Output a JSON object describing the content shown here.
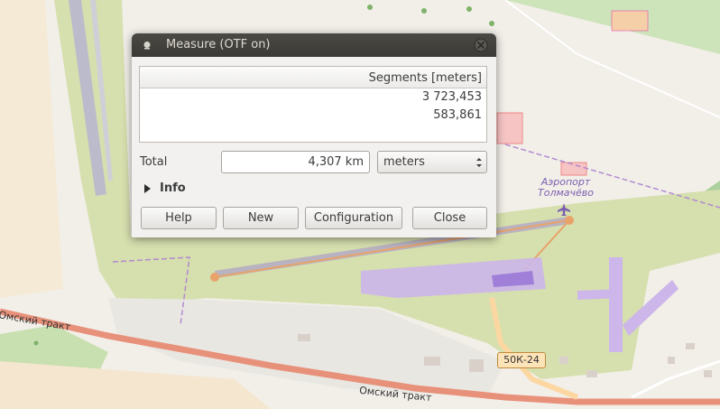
{
  "map": {
    "road_labels": [
      "Омский тракт",
      "Омский тракт"
    ],
    "road_shield": "50К-24",
    "airport_label": "Аэропорт Толмачёво",
    "icons": [
      "airport-icon",
      "tree-icon"
    ],
    "colors": {
      "land": "#f2efe9",
      "airport_grass": "#d6dfae",
      "runway": "#bbbbcc",
      "terminal": "#ccb6ea",
      "main_road": "#e8917a",
      "secondary_road": "#fdd7a1",
      "forest": "#add19e",
      "measure_line": "#e8a36a"
    }
  },
  "dialog": {
    "title": "Measure (OTF on)",
    "table": {
      "header": "Segments [meters]",
      "rows": [
        "3 723,453",
        "583,861"
      ]
    },
    "total_label": "Total",
    "total_value": "4,307 km",
    "unit_selected": "meters",
    "info_label": "Info",
    "buttons": {
      "help": "Help",
      "new": "New",
      "configuration": "Configuration",
      "close": "Close"
    },
    "icons": [
      "window-icon",
      "close-icon",
      "expand-arrow-icon",
      "select-arrows-icon"
    ]
  }
}
